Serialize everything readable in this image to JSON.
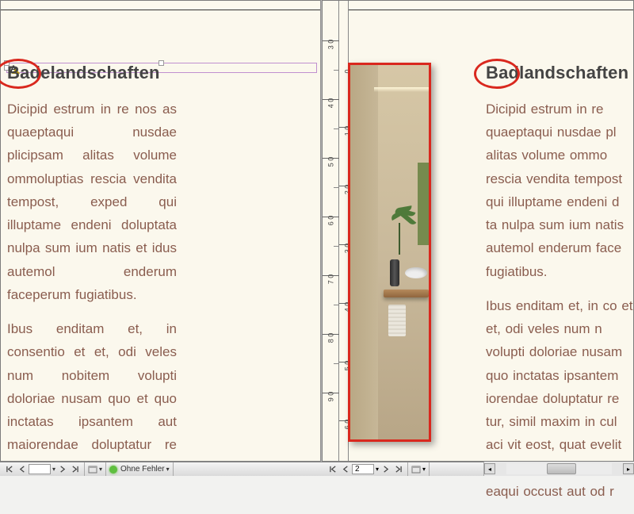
{
  "left_page": {
    "heading": "Badelandschaften",
    "paragraphs": [
      "Dicipid estrum in re nos as quaeptaqui nusdae plicipsam alitas volume ommoluptias rescia vendita tempost, exped qui illuptame endeni doluptata nulpa sum ium natis et idus autemol enderum faceperum fugiatibus.",
      "Ibus enditam et, in consentio et et, odi veles num nobitem volupti doloriae nusam quo et quo inctatas ipsantem aut maiorendae doluptatur re endiatur, simil"
    ]
  },
  "right_page": {
    "heading": "Badlandschaften",
    "paragraphs": [
      "Dicipid estrum in re quaeptaqui nusdae pl alitas volume ommo rescia vendita tempost qui illuptame endeni d ta nulpa sum ium natis autemol enderum face fugiatibus.",
      "Ibus enditam et, in co et et, odi veles num n volupti doloriae nusam quo inctatas ipsantem iorendae doluptatur re tur, simil maxim in cul aci vit eost, quat evelit to et.Ditectist arcit lam a eaqui occust aut od r"
    ]
  },
  "ruler": {
    "marks": [
      "3 0",
      "4 0",
      "5 0",
      "6 0",
      "7 0",
      "8 0",
      "9 0"
    ],
    "marks2": [
      "0",
      "1 0",
      "2 0",
      "3 0",
      "4 0",
      "5 0",
      "6 0"
    ]
  },
  "statusbar_left": {
    "page_field_value": "",
    "preflight_label": "Ohne Fehler"
  },
  "statusbar_right": {
    "page_field_value": "2"
  },
  "annotations": {
    "circle_color": "#d9281e",
    "image_border_color": "#d9281e"
  }
}
